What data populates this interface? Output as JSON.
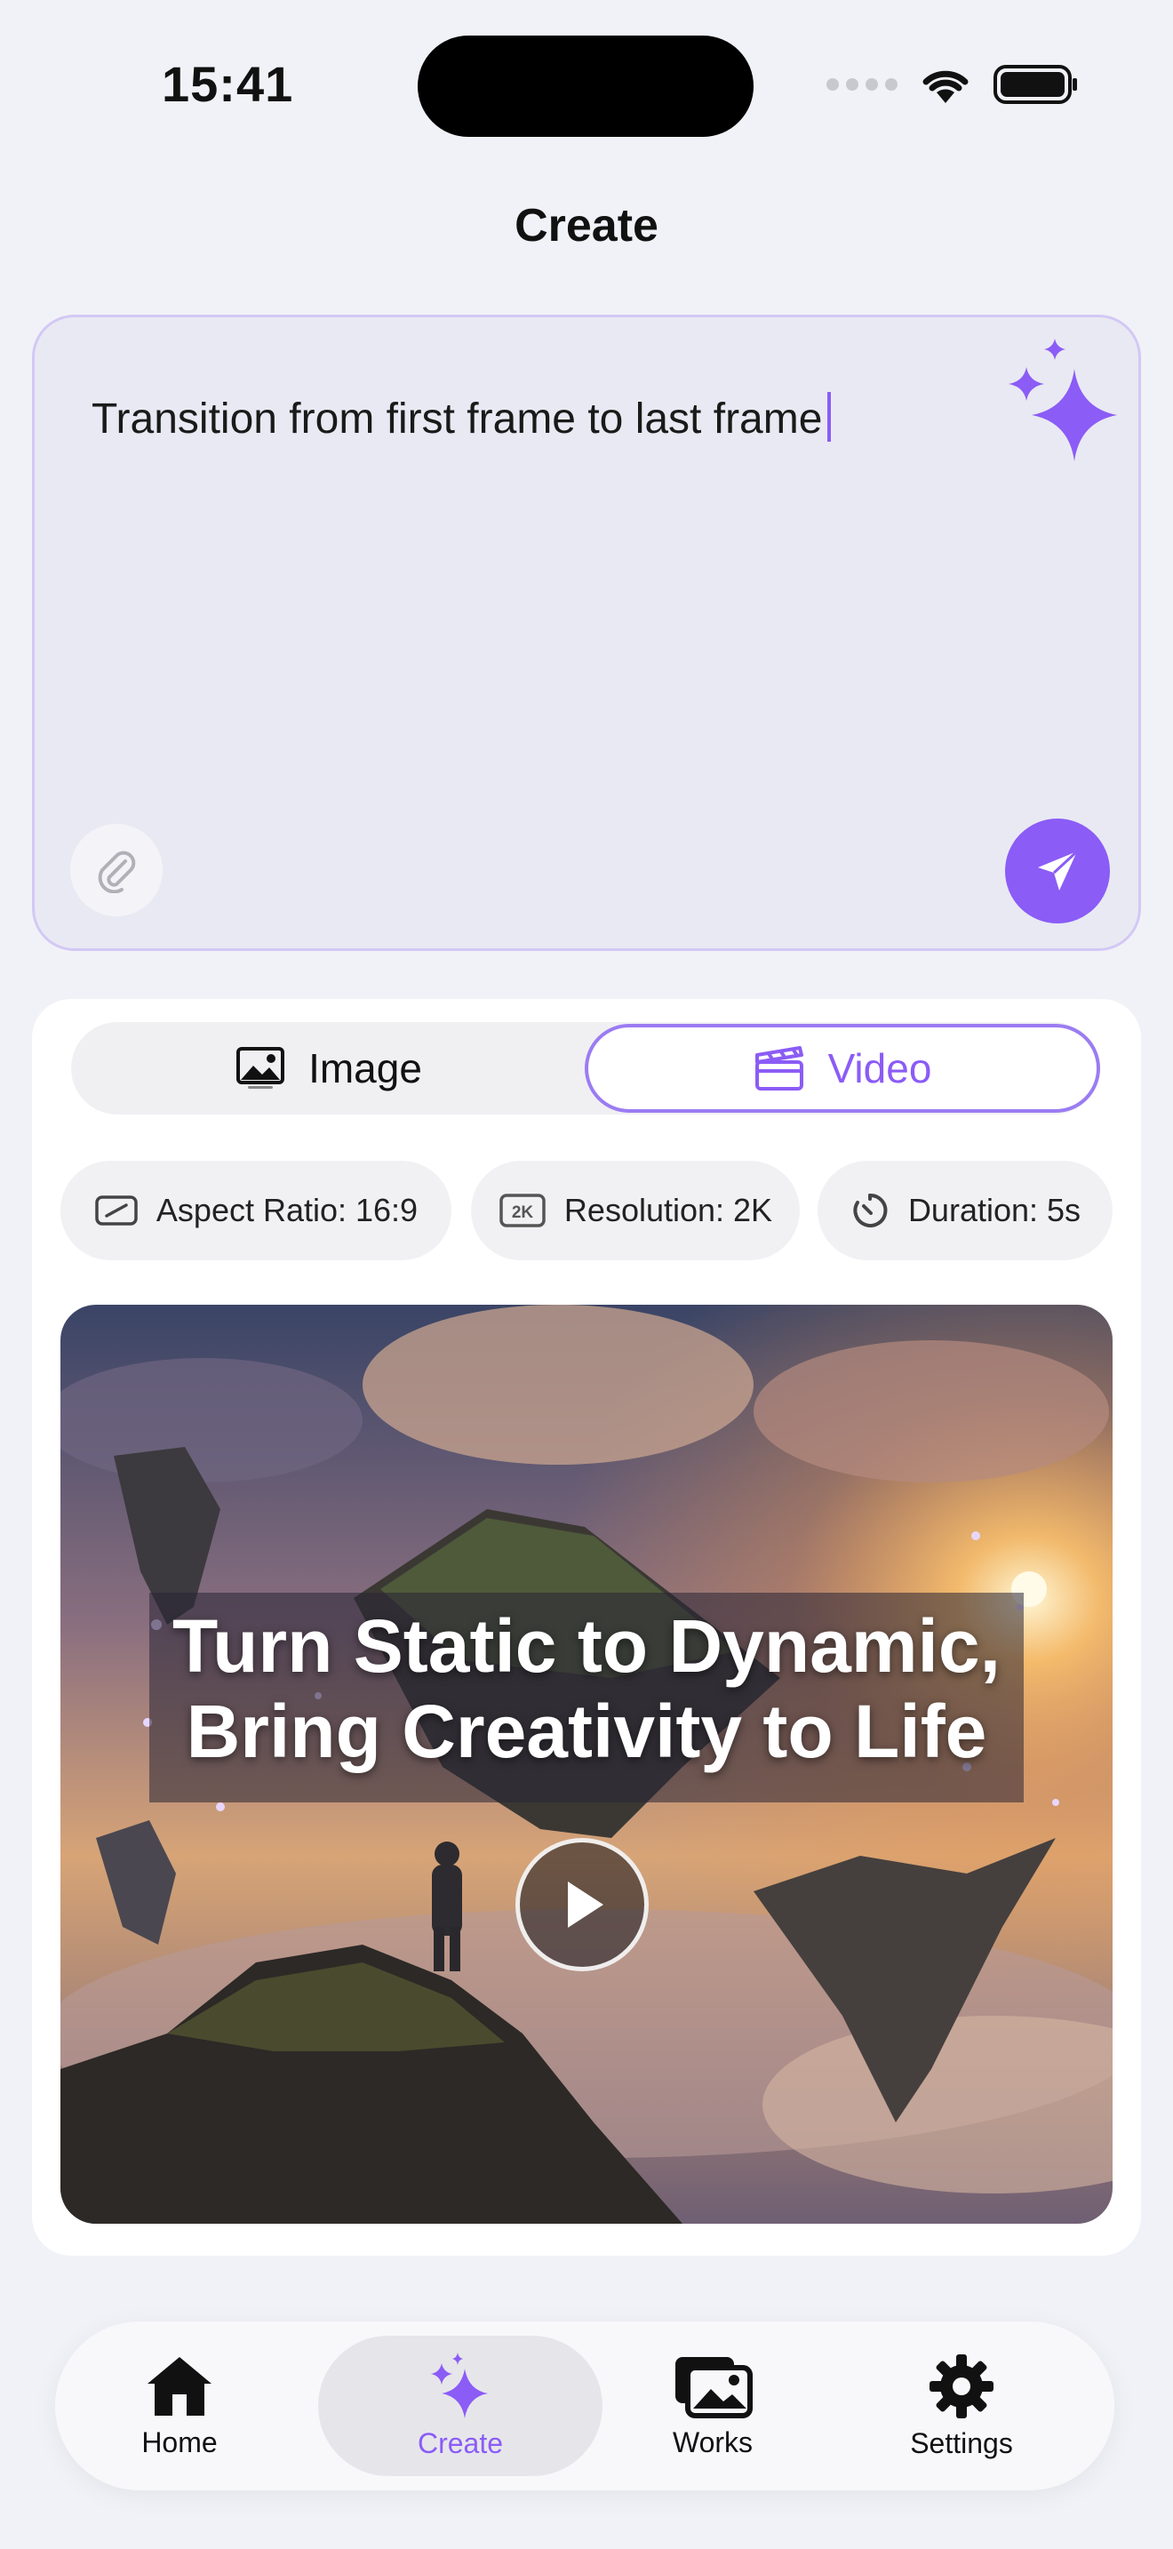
{
  "status_bar": {
    "time": "15:41"
  },
  "header": {
    "title": "Create"
  },
  "prompt": {
    "text": "Transition from first frame to last frame",
    "icons": {
      "magic": "sparkle-icon",
      "attach": "paperclip-icon",
      "send": "paper-plane-icon"
    }
  },
  "media_type": {
    "options": [
      {
        "label": "Image",
        "icon": "image-icon",
        "selected": false
      },
      {
        "label": "Video",
        "icon": "clapperboard-icon",
        "selected": true
      }
    ]
  },
  "settings": {
    "aspect_ratio": "Aspect Ratio: 16:9",
    "resolution": "Resolution: 2K",
    "resolution_badge": "2K",
    "duration": "Duration: 5s"
  },
  "preview": {
    "headline_line1": "Turn Static to Dynamic,",
    "headline_line2": "Bring Creativity to Life"
  },
  "tabbar": {
    "items": [
      {
        "label": "Home",
        "icon": "home-icon"
      },
      {
        "label": "Create",
        "icon": "sparkle-icon",
        "active": true
      },
      {
        "label": "Works",
        "icon": "gallery-icon"
      },
      {
        "label": "Settings",
        "icon": "gear-icon"
      }
    ]
  },
  "colors": {
    "accent": "#8b5cf6",
    "background": "#f1f2f7"
  }
}
